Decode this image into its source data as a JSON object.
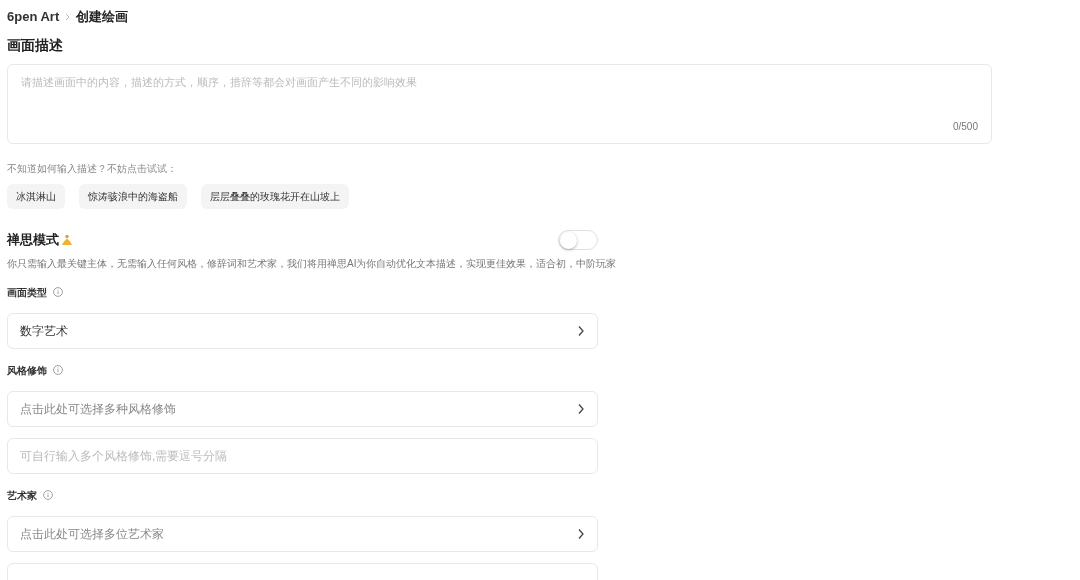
{
  "breadcrumb": {
    "root": "6pen Art",
    "current": "创建绘画"
  },
  "description": {
    "title": "画面描述",
    "placeholder": "请描述画面中的内容，描述的方式，顺序，措辞等都会对画面产生不同的影响效果",
    "counter": "0/500"
  },
  "suggestions": {
    "hint": "不知道如何输入描述？不妨点击试试：",
    "chips": [
      "冰淇淋山",
      "惊涛骇浪中的海盗船",
      "层层叠叠的玫瑰花开在山坡上"
    ]
  },
  "zen_mode": {
    "title": "禅思模式",
    "on": false,
    "note": "你只需输入最关键主体，无需输入任何风格，修辞词和艺术家，我们将用禅思AI为你自动优化文本描述，实现更佳效果，适合初，中阶玩家"
  },
  "sections": [
    {
      "label": "画面类型",
      "fields": [
        {
          "kind": "select",
          "value": "数字艺术"
        }
      ]
    },
    {
      "label": "风格修饰",
      "fields": [
        {
          "kind": "select",
          "placeholder": "点击此处可选择多种风格修饰"
        },
        {
          "kind": "input",
          "placeholder": "可自行输入多个风格修饰,需要逗号分隔"
        }
      ]
    },
    {
      "label": "艺术家",
      "fields": [
        {
          "kind": "select",
          "placeholder": "点击此处可选择多位艺术家"
        }
      ]
    }
  ]
}
